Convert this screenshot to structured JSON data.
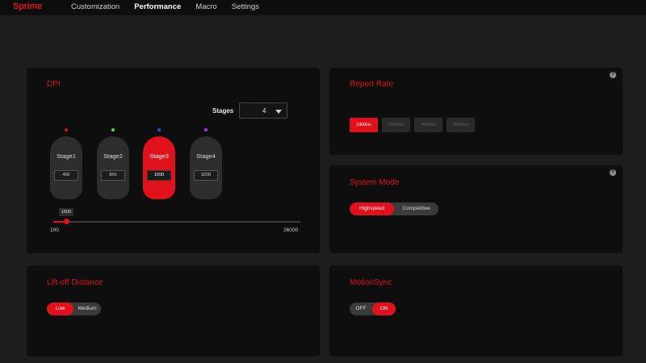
{
  "app": {
    "brand": "Sprime"
  },
  "nav": {
    "items": [
      {
        "label": "Customization"
      },
      {
        "label": "Performance"
      },
      {
        "label": "Macro"
      },
      {
        "label": "Settings"
      }
    ],
    "active": "Performance"
  },
  "dpi": {
    "title": "DPI",
    "stages_label": "Stages",
    "stages_value": "4",
    "stages": [
      {
        "name": "Stage1",
        "value": "400",
        "dot_color": "#e0111b"
      },
      {
        "name": "Stage2",
        "value": "800",
        "dot_color": "#4fdc4f"
      },
      {
        "name": "Stage3",
        "value": "1600",
        "dot_color": "#2f4fe0"
      },
      {
        "name": "Stage4",
        "value": "3200",
        "dot_color": "#b02fe0"
      }
    ],
    "active_stage": 2,
    "slider": {
      "value": "1600",
      "min": "100",
      "max": "26000"
    }
  },
  "report_rate": {
    "title": "Report Rate",
    "help": "?",
    "options": [
      "1000Hz",
      "2000Hz",
      "4000Hz",
      "8000Hz"
    ],
    "selected": "1000Hz"
  },
  "system_mode": {
    "title": "System Mode",
    "help": "?",
    "options": [
      "Highspeed",
      "Competitive"
    ],
    "selected": "Highspeed"
  },
  "lift_off": {
    "title": "Lift-off Distance",
    "options": [
      "Low",
      "Medium"
    ],
    "selected": "Low"
  },
  "motion_sync": {
    "title": "MotionSync",
    "options": [
      "OFF",
      "ON"
    ],
    "selected": "ON"
  },
  "colors": {
    "accent": "#e0111b",
    "background": "#1d1d1d",
    "card": "#0e0e0e"
  },
  "icons": {
    "help": "help-circle-icon",
    "dropdown": "chevron-down-icon"
  }
}
